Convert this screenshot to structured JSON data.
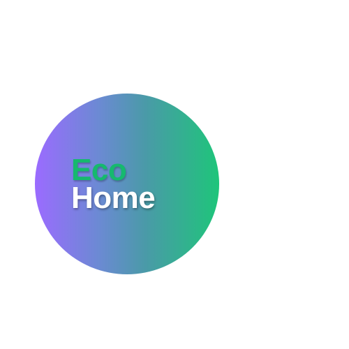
{
  "logo": {
    "line1": "Eco",
    "line2": "Home",
    "colors": {
      "gradient_start": "#9b6bff",
      "gradient_mid": "#4a9aa8",
      "gradient_end": "#1ec57a",
      "eco_text": "#16b96e",
      "home_text": "#ffffff",
      "background": "#ffffff"
    }
  }
}
